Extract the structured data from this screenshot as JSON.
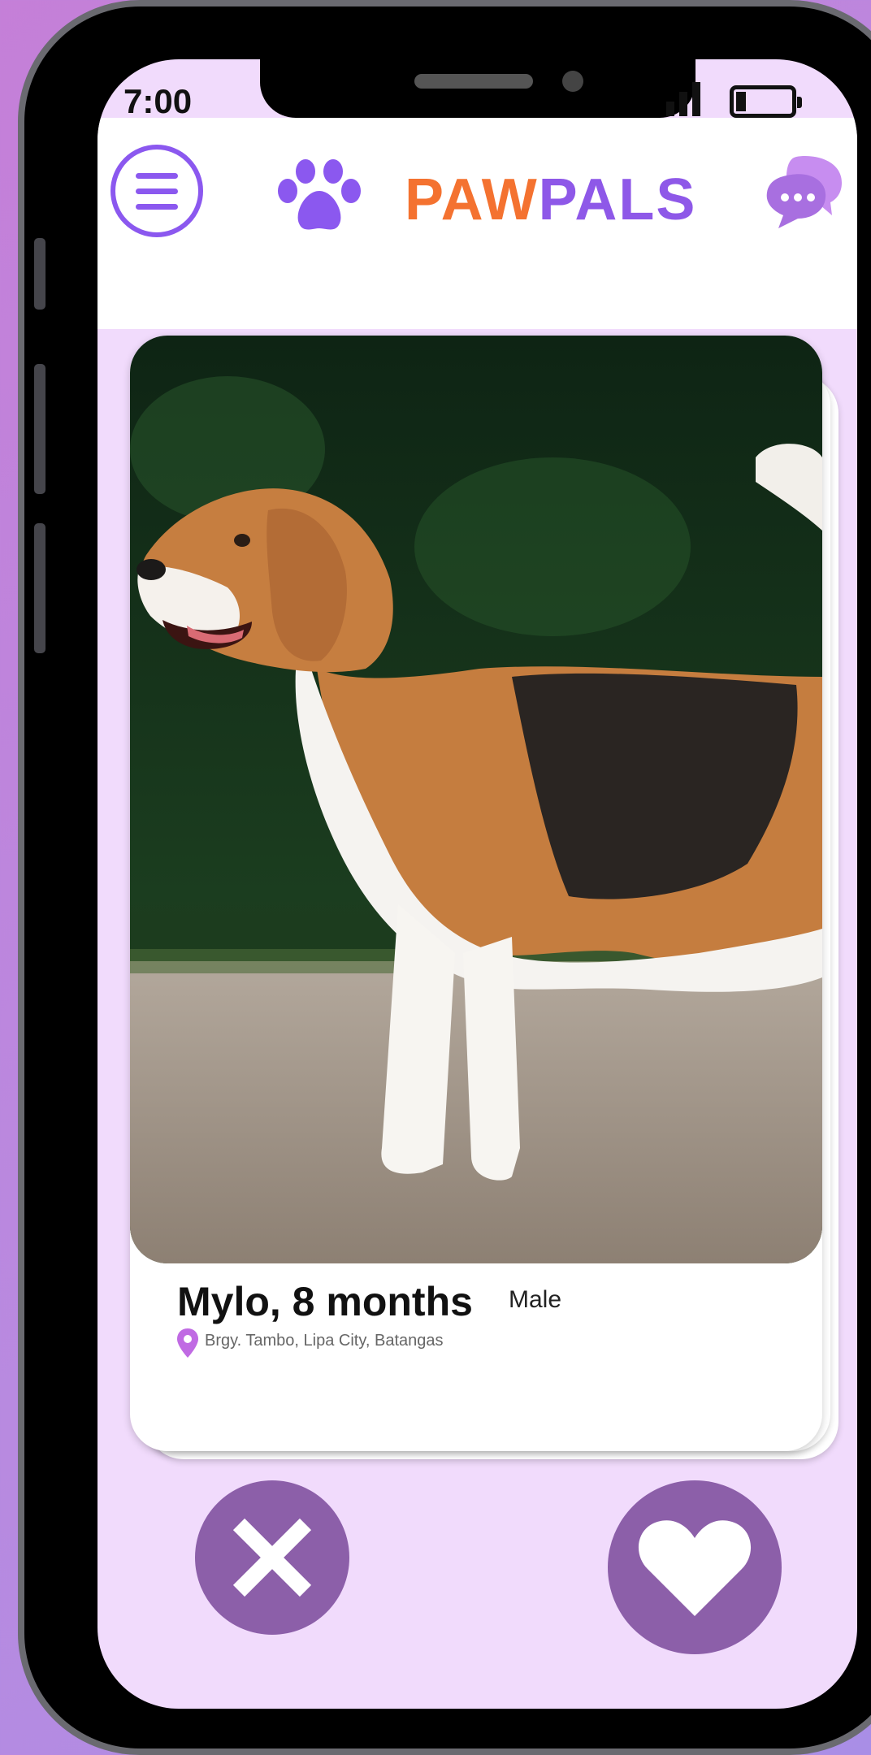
{
  "status_bar": {
    "time": "7:00"
  },
  "header": {
    "logo_part1": "PAW",
    "logo_part2": "PALS",
    "menu_icon": "hamburger-menu-icon",
    "chat_icon": "chat-bubbles-icon"
  },
  "profile": {
    "name": "Mylo, 8 months",
    "gender": "Male",
    "location": "Brgy. Tambo, Lipa City, Batangas"
  },
  "actions": {
    "dislike_icon": "close-x-icon",
    "like_icon": "heart-icon"
  },
  "colors": {
    "screen_background": "#f1dbfc",
    "accent_purple": "#8b58ef",
    "logo_orange": "#f47230",
    "action_button": "#8c5fa9"
  }
}
